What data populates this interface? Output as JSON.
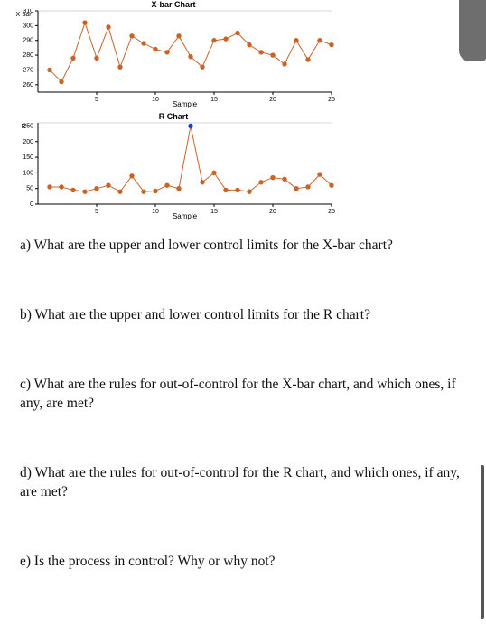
{
  "chart_data": [
    {
      "type": "line",
      "title": "X-bar Chart",
      "xlabel": "Sample",
      "ylabel": "X-bar",
      "x": [
        1,
        2,
        3,
        4,
        5,
        6,
        7,
        8,
        9,
        10,
        11,
        12,
        13,
        14,
        15,
        16,
        17,
        18,
        19,
        20,
        21,
        22,
        23,
        24,
        25
      ],
      "values": [
        270,
        262,
        278,
        302,
        278,
        299,
        272,
        293,
        288,
        284,
        282,
        293,
        279,
        272,
        290,
        291,
        295,
        287,
        282,
        280,
        274,
        290,
        277,
        290,
        287
      ],
      "ylim": [
        255,
        310
      ],
      "xlim": [
        0,
        25
      ],
      "yticks": [
        260,
        270,
        280,
        290,
        300,
        310
      ],
      "xticks": [
        5,
        10,
        15,
        20,
        25
      ]
    },
    {
      "type": "line",
      "title": "R Chart",
      "xlabel": "Sample",
      "ylabel": "R",
      "x": [
        1,
        2,
        3,
        4,
        5,
        6,
        7,
        8,
        9,
        10,
        11,
        12,
        13,
        14,
        15,
        16,
        17,
        18,
        19,
        20,
        21,
        22,
        23,
        24,
        25
      ],
      "values": [
        55,
        55,
        45,
        40,
        50,
        60,
        40,
        90,
        40,
        42,
        60,
        50,
        250,
        70,
        100,
        45,
        45,
        40,
        70,
        85,
        80,
        50,
        55,
        95,
        60
      ],
      "ylim": [
        0,
        260
      ],
      "xlim": [
        0,
        25
      ],
      "yticks": [
        0,
        50,
        100,
        150,
        200,
        250
      ],
      "xticks": [
        5,
        10,
        15,
        20,
        25
      ],
      "highlight_index": 12
    }
  ],
  "questions": {
    "a": {
      "label": "a)",
      "text": "What are the upper and lower control limits for the X-bar chart?"
    },
    "b": {
      "label": "b)",
      "text": "What are the upper and lower control limits for the R chart?"
    },
    "c": {
      "label": "c)",
      "text": "What are the rules for out-of-control for the X-bar chart, and which ones, if any, are met?"
    },
    "d": {
      "label": "d)",
      "text": "What are the rules for out-of-control for the R chart, and which ones, if any, are met?"
    },
    "e": {
      "label": "e)",
      "text": "Is the process in control? Why or why not?"
    }
  }
}
